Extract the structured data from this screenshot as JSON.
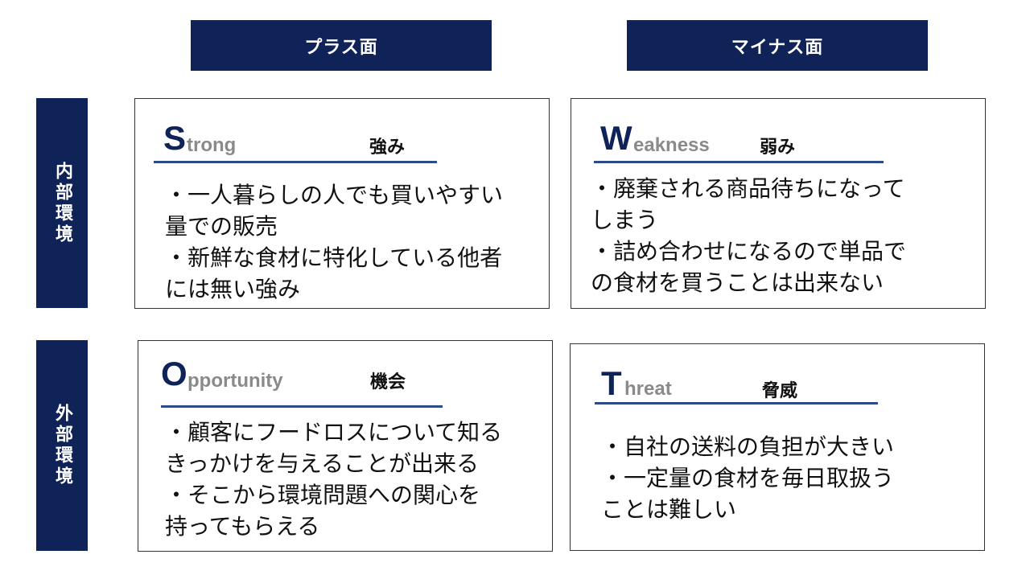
{
  "columns": {
    "plus": "プラス面",
    "minus": "マイナス面"
  },
  "rows": {
    "internal": "内部環境",
    "external": "外部環境"
  },
  "quadrants": {
    "strength": {
      "initial": "S",
      "word": "trong",
      "jp": "強み",
      "body": "・一人暮らしの人でも買いやすい\n量での販売\n・新鮮な食材に特化している他者\nには無い強み"
    },
    "weakness": {
      "initial": "W",
      "word": "eakness",
      "jp": "弱み",
      "body": "・廃棄される商品待ちになって\nしまう\n・詰め合わせになるので単品で\nの食材を買うことは出来ない"
    },
    "opportunity": {
      "initial": "O",
      "word": "pportunity",
      "jp": "機会",
      "body": "・顧客にフードロスについて知る\nきっかけを与えることが出来る\n・そこから環境問題への関心を\n持ってもらえる"
    },
    "threat": {
      "initial": "T",
      "word": "hreat",
      "jp": "脅威",
      "body": "・自社の送料の負担が大きい\n・一定量の食材を毎日取扱う\nことは難しい"
    }
  },
  "colors": {
    "navy": "#0f2358",
    "underline": "#2c4a8c",
    "gray_text": "#8a8a8a"
  }
}
